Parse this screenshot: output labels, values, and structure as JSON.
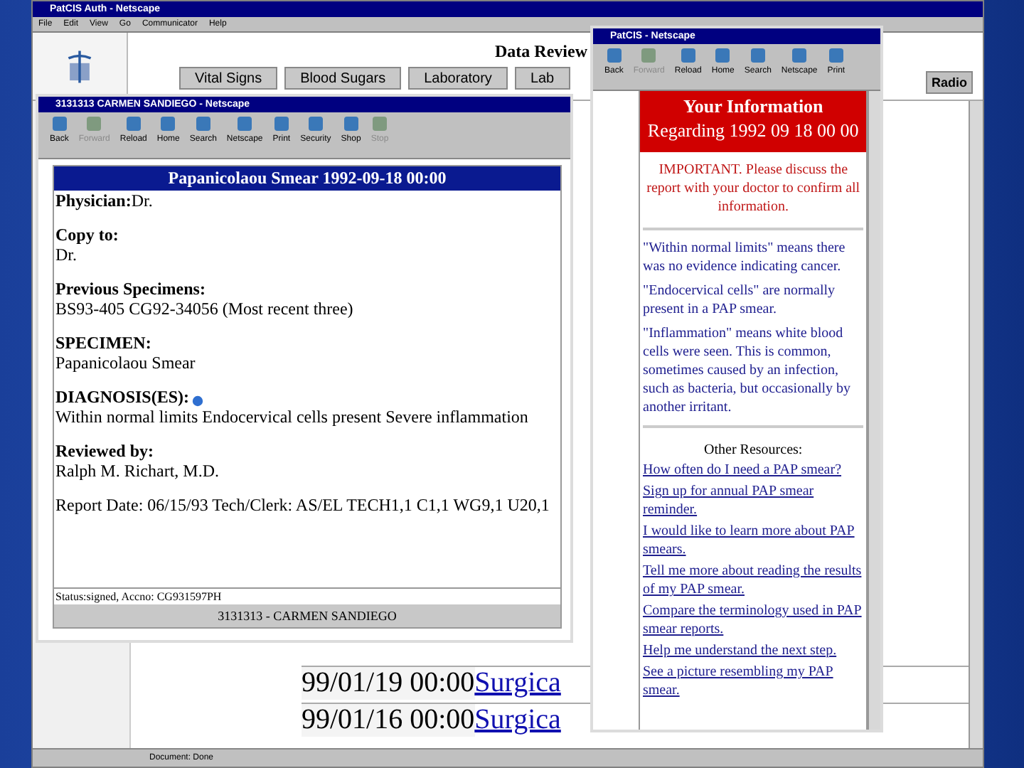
{
  "main_window": {
    "title": "PatCIS Auth - Netscape",
    "menu": [
      "File",
      "Edit",
      "View",
      "Go",
      "Communicator",
      "Help"
    ],
    "header": "Data Review",
    "nav_buttons": [
      "Vital Signs",
      "Blood Sugars",
      "Laboratory",
      "Lab"
    ],
    "side_button": "Radio",
    "rows": [
      {
        "date": "99/01/19 00:00",
        "link": "Surgica"
      },
      {
        "date": "99/01/16 00:00",
        "link": "Surgica"
      }
    ],
    "status": "Document: Done"
  },
  "report_window": {
    "title": "3131313 CARMEN SANDIEGO - Netscape",
    "toolbar": [
      {
        "label": "Back",
        "disabled": false
      },
      {
        "label": "Forward",
        "disabled": true
      },
      {
        "label": "Reload",
        "disabled": false
      },
      {
        "label": "Home",
        "disabled": false
      },
      {
        "label": "Search",
        "disabled": false
      },
      {
        "label": "Netscape",
        "disabled": false
      },
      {
        "label": "Print",
        "disabled": false
      },
      {
        "label": "Security",
        "disabled": false
      },
      {
        "label": "Shop",
        "disabled": false
      },
      {
        "label": "Stop",
        "disabled": true
      }
    ],
    "report_title": "Papanicolaou Smear 1992-09-18 00:00",
    "sections": [
      {
        "kind": "inline",
        "label": "Physician:",
        "value": "Dr.",
        "info_icon": false
      },
      {
        "kind": "block",
        "label": "Copy to:",
        "value": "Dr.",
        "info_icon": false
      },
      {
        "kind": "block",
        "label": "Previous Specimens:",
        "value": "BS93-405 CG92-34056 (Most recent three)",
        "info_icon": false
      },
      {
        "kind": "block",
        "label": "SPECIMEN:",
        "value": "Papanicolaou Smear",
        "info_icon": false
      },
      {
        "kind": "block",
        "label": "DIAGNOSIS(ES):",
        "value": "Within normal limits Endocervical cells present Severe inflammation",
        "info_icon": true
      },
      {
        "kind": "block",
        "label": "Reviewed by:",
        "value": "Ralph M. Richart, M.D.",
        "info_icon": false
      }
    ],
    "report_date": "Report Date: 06/15/93 Tech/Clerk: AS/EL TECH1,1 C1,1 WG9,1 U20,1",
    "status_line": "Status:signed, Accno: CG931597PH",
    "footer": "3131313 - CARMEN SANDIEGO"
  },
  "info_window": {
    "title": "PatCIS - Netscape",
    "toolbar": [
      {
        "label": "Back",
        "disabled": false
      },
      {
        "label": "Forward",
        "disabled": true
      },
      {
        "label": "Reload",
        "disabled": false
      },
      {
        "label": "Home",
        "disabled": false
      },
      {
        "label": "Search",
        "disabled": false
      },
      {
        "label": "Netscape",
        "disabled": false
      },
      {
        "label": "Print",
        "disabled": false
      }
    ],
    "heading": "Your Information",
    "subheading": "Regarding 1992 09 18 00 00",
    "important": "IMPORTANT. Please discuss the report with your doctor to confirm all information.",
    "explanations": [
      "\"Within normal limits\" means there was no evidence indicating cancer.",
      "\"Endocervical cells\" are normally present in a PAP smear.",
      "\"Inflammation\" means white blood cells were seen. This is common, sometimes caused by an infection, such as bacteria, but occasionally by another irritant."
    ],
    "resources_heading": "Other Resources:",
    "links": [
      "How often do I need a PAP smear?",
      "Sign up for annual PAP smear reminder.",
      "I would like to learn more about PAP smears.",
      "Tell me more about reading the results of my PAP smear.",
      "Compare the terminology used in PAP smear reports.",
      "Help me understand the next step.",
      "See a picture resembling my PAP smear."
    ]
  }
}
